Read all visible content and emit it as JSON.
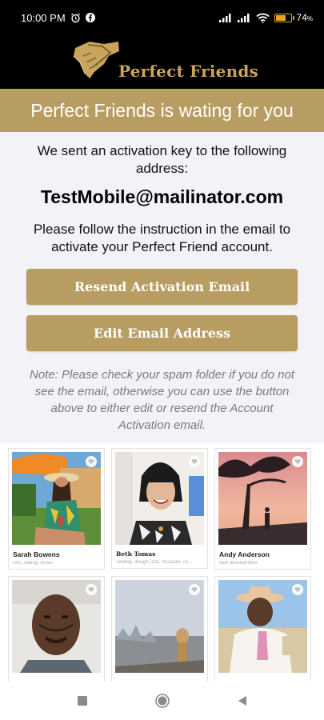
{
  "status_bar": {
    "time": "10:00 PM",
    "battery_percent": "74",
    "battery_level": 0.74,
    "icons": [
      "alarm-icon",
      "facebook-icon",
      "signal-icon",
      "signal-icon",
      "wifi-icon",
      "battery-icon"
    ]
  },
  "header": {
    "logo_text": "Perfect Friends",
    "logo_icon": "handshake-icon"
  },
  "banner": {
    "title": "Perfect Friends is wating for you"
  },
  "activation": {
    "message_1": "We sent an activation key to the following address:",
    "email": "TestMobile@mailinator.com",
    "message_2": "Please follow the instruction in the email to activate your Perfect Friend account.",
    "resend_label": "Resend Activation Email",
    "edit_label": "Edit Email Address",
    "note": "Note: Please check your spam folder if you do not see the email, otherwise you can use the button above to either edit or resend the Account Activation email."
  },
  "profiles": [
    {
      "name": "Sarah Bowens",
      "tags": "Arts, sailing, music"
    },
    {
      "name": "Beth Tomas",
      "tags": "Sewing, design, arts, musicals, co..."
    },
    {
      "name": "Andy Anderson",
      "tags": "web development"
    },
    {
      "name": "",
      "tags": ""
    },
    {
      "name": "",
      "tags": ""
    },
    {
      "name": "",
      "tags": ""
    }
  ],
  "colors": {
    "gold": "#b89d62",
    "logo_gold": "#c8a45c",
    "background": "#f3f2f7"
  }
}
